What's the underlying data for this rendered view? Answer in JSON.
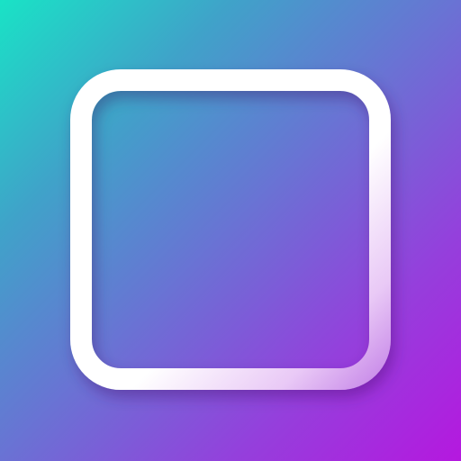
{
  "icon": {
    "name": "collage-layout-icon",
    "colors": {
      "gradient_start": "#19e3c6",
      "gradient_mid": "#6a72d4",
      "gradient_end": "#b518df",
      "glyph_stroke": "#ffffff"
    }
  }
}
